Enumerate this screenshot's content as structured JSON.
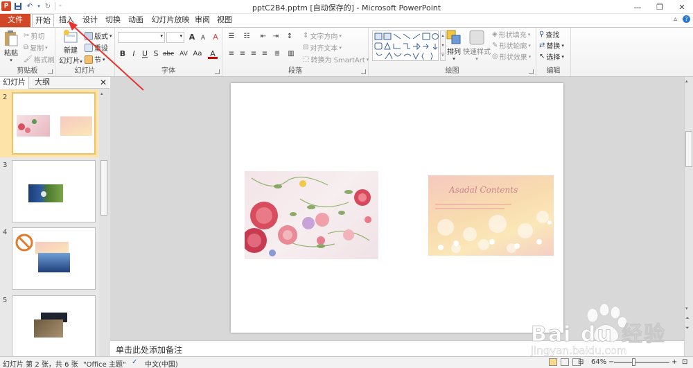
{
  "app": {
    "title": "pptC2B4.pptm [自动保存的] - Microsoft PowerPoint",
    "icon_letter": "P"
  },
  "window_controls": [
    "—",
    "❐",
    "✕"
  ],
  "tabs": [
    {
      "label": "文件",
      "kind": "file"
    },
    {
      "label": "开始",
      "kind": "active"
    },
    {
      "label": "插入",
      "kind": "normal"
    },
    {
      "label": "设计",
      "kind": "normal"
    },
    {
      "label": "切换",
      "kind": "normal"
    },
    {
      "label": "动画",
      "kind": "normal"
    },
    {
      "label": "幻灯片放映",
      "kind": "normal"
    },
    {
      "label": "审阅",
      "kind": "normal"
    },
    {
      "label": "视图",
      "kind": "normal"
    }
  ],
  "ribbon": {
    "clipboard": {
      "label": "剪贴板",
      "paste": "粘贴",
      "cut": "剪切",
      "copy": "复制",
      "format_painter": "格式刷"
    },
    "slides": {
      "label": "幻灯片",
      "new_slide": "新建",
      "new_slide_2": "幻灯片",
      "layout": "版式",
      "reset": "重设",
      "section": "节"
    },
    "font": {
      "label": "字体",
      "bold": "B",
      "italic": "I",
      "underline": "U",
      "shadow": "S",
      "strike": "abc",
      "spacing": "AV",
      "case": "Aa",
      "grow": "A",
      "shrink": "A",
      "clear": "A",
      "color": "A"
    },
    "paragraph": {
      "label": "段落",
      "text_direction": "文字方向",
      "align_text": "对齐文本",
      "smartart": "转换为 SmartArt"
    },
    "drawing": {
      "label": "绘图",
      "arrange": "排列",
      "quick_styles": "快速样式",
      "shape_fill": "形状填充",
      "shape_outline": "形状轮廓",
      "shape_effects": "形状效果"
    },
    "editing": {
      "label": "编辑",
      "find": "查找",
      "replace": "替换",
      "select": "选择"
    }
  },
  "left_pane": {
    "tabs": [
      "幻灯片",
      "大纲"
    ],
    "close": "✕",
    "slides": [
      {
        "number": "2",
        "selected": true
      },
      {
        "number": "3",
        "selected": false
      },
      {
        "number": "4",
        "selected": false
      },
      {
        "number": "5",
        "selected": false
      }
    ]
  },
  "notes": {
    "placeholder": "单击此处添加备注"
  },
  "slide_content": {
    "image2_text": "Asadal Contents"
  },
  "status_bar": {
    "slide_info": "幻灯片 第 2 张，共 6 张",
    "theme": "\"Office 主题\"",
    "language": "中文(中国)",
    "zoom": "64%",
    "zoom_minus": "−",
    "zoom_plus": "+"
  },
  "watermark": {
    "brand": "Bai du 经验",
    "url": "jingyan.baidu.com"
  },
  "colors": {
    "file_tab": "#d24726",
    "selection": "#f1c15f",
    "annotation_arrow": "#e8332d"
  }
}
